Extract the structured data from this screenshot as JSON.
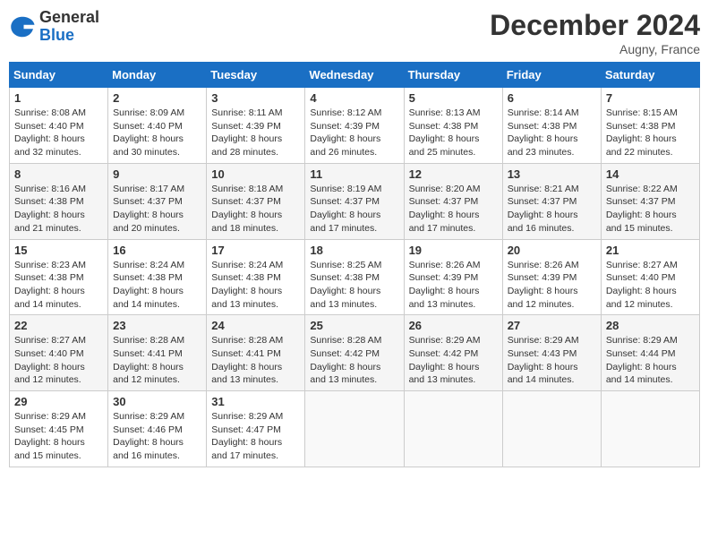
{
  "logo": {
    "general": "General",
    "blue": "Blue"
  },
  "title": "December 2024",
  "location": "Augny, France",
  "days_header": [
    "Sunday",
    "Monday",
    "Tuesday",
    "Wednesday",
    "Thursday",
    "Friday",
    "Saturday"
  ],
  "weeks": [
    [
      {
        "day": "1",
        "info": "Sunrise: 8:08 AM\nSunset: 4:40 PM\nDaylight: 8 hours\nand 32 minutes."
      },
      {
        "day": "2",
        "info": "Sunrise: 8:09 AM\nSunset: 4:40 PM\nDaylight: 8 hours\nand 30 minutes."
      },
      {
        "day": "3",
        "info": "Sunrise: 8:11 AM\nSunset: 4:39 PM\nDaylight: 8 hours\nand 28 minutes."
      },
      {
        "day": "4",
        "info": "Sunrise: 8:12 AM\nSunset: 4:39 PM\nDaylight: 8 hours\nand 26 minutes."
      },
      {
        "day": "5",
        "info": "Sunrise: 8:13 AM\nSunset: 4:38 PM\nDaylight: 8 hours\nand 25 minutes."
      },
      {
        "day": "6",
        "info": "Sunrise: 8:14 AM\nSunset: 4:38 PM\nDaylight: 8 hours\nand 23 minutes."
      },
      {
        "day": "7",
        "info": "Sunrise: 8:15 AM\nSunset: 4:38 PM\nDaylight: 8 hours\nand 22 minutes."
      }
    ],
    [
      {
        "day": "8",
        "info": "Sunrise: 8:16 AM\nSunset: 4:38 PM\nDaylight: 8 hours\nand 21 minutes."
      },
      {
        "day": "9",
        "info": "Sunrise: 8:17 AM\nSunset: 4:37 PM\nDaylight: 8 hours\nand 20 minutes."
      },
      {
        "day": "10",
        "info": "Sunrise: 8:18 AM\nSunset: 4:37 PM\nDaylight: 8 hours\nand 18 minutes."
      },
      {
        "day": "11",
        "info": "Sunrise: 8:19 AM\nSunset: 4:37 PM\nDaylight: 8 hours\nand 17 minutes."
      },
      {
        "day": "12",
        "info": "Sunrise: 8:20 AM\nSunset: 4:37 PM\nDaylight: 8 hours\nand 17 minutes."
      },
      {
        "day": "13",
        "info": "Sunrise: 8:21 AM\nSunset: 4:37 PM\nDaylight: 8 hours\nand 16 minutes."
      },
      {
        "day": "14",
        "info": "Sunrise: 8:22 AM\nSunset: 4:37 PM\nDaylight: 8 hours\nand 15 minutes."
      }
    ],
    [
      {
        "day": "15",
        "info": "Sunrise: 8:23 AM\nSunset: 4:38 PM\nDaylight: 8 hours\nand 14 minutes."
      },
      {
        "day": "16",
        "info": "Sunrise: 8:24 AM\nSunset: 4:38 PM\nDaylight: 8 hours\nand 14 minutes."
      },
      {
        "day": "17",
        "info": "Sunrise: 8:24 AM\nSunset: 4:38 PM\nDaylight: 8 hours\nand 13 minutes."
      },
      {
        "day": "18",
        "info": "Sunrise: 8:25 AM\nSunset: 4:38 PM\nDaylight: 8 hours\nand 13 minutes."
      },
      {
        "day": "19",
        "info": "Sunrise: 8:26 AM\nSunset: 4:39 PM\nDaylight: 8 hours\nand 13 minutes."
      },
      {
        "day": "20",
        "info": "Sunrise: 8:26 AM\nSunset: 4:39 PM\nDaylight: 8 hours\nand 12 minutes."
      },
      {
        "day": "21",
        "info": "Sunrise: 8:27 AM\nSunset: 4:40 PM\nDaylight: 8 hours\nand 12 minutes."
      }
    ],
    [
      {
        "day": "22",
        "info": "Sunrise: 8:27 AM\nSunset: 4:40 PM\nDaylight: 8 hours\nand 12 minutes."
      },
      {
        "day": "23",
        "info": "Sunrise: 8:28 AM\nSunset: 4:41 PM\nDaylight: 8 hours\nand 12 minutes."
      },
      {
        "day": "24",
        "info": "Sunrise: 8:28 AM\nSunset: 4:41 PM\nDaylight: 8 hours\nand 13 minutes."
      },
      {
        "day": "25",
        "info": "Sunrise: 8:28 AM\nSunset: 4:42 PM\nDaylight: 8 hours\nand 13 minutes."
      },
      {
        "day": "26",
        "info": "Sunrise: 8:29 AM\nSunset: 4:42 PM\nDaylight: 8 hours\nand 13 minutes."
      },
      {
        "day": "27",
        "info": "Sunrise: 8:29 AM\nSunset: 4:43 PM\nDaylight: 8 hours\nand 14 minutes."
      },
      {
        "day": "28",
        "info": "Sunrise: 8:29 AM\nSunset: 4:44 PM\nDaylight: 8 hours\nand 14 minutes."
      }
    ],
    [
      {
        "day": "29",
        "info": "Sunrise: 8:29 AM\nSunset: 4:45 PM\nDaylight: 8 hours\nand 15 minutes."
      },
      {
        "day": "30",
        "info": "Sunrise: 8:29 AM\nSunset: 4:46 PM\nDaylight: 8 hours\nand 16 minutes."
      },
      {
        "day": "31",
        "info": "Sunrise: 8:29 AM\nSunset: 4:47 PM\nDaylight: 8 hours\nand 17 minutes."
      },
      null,
      null,
      null,
      null
    ]
  ]
}
